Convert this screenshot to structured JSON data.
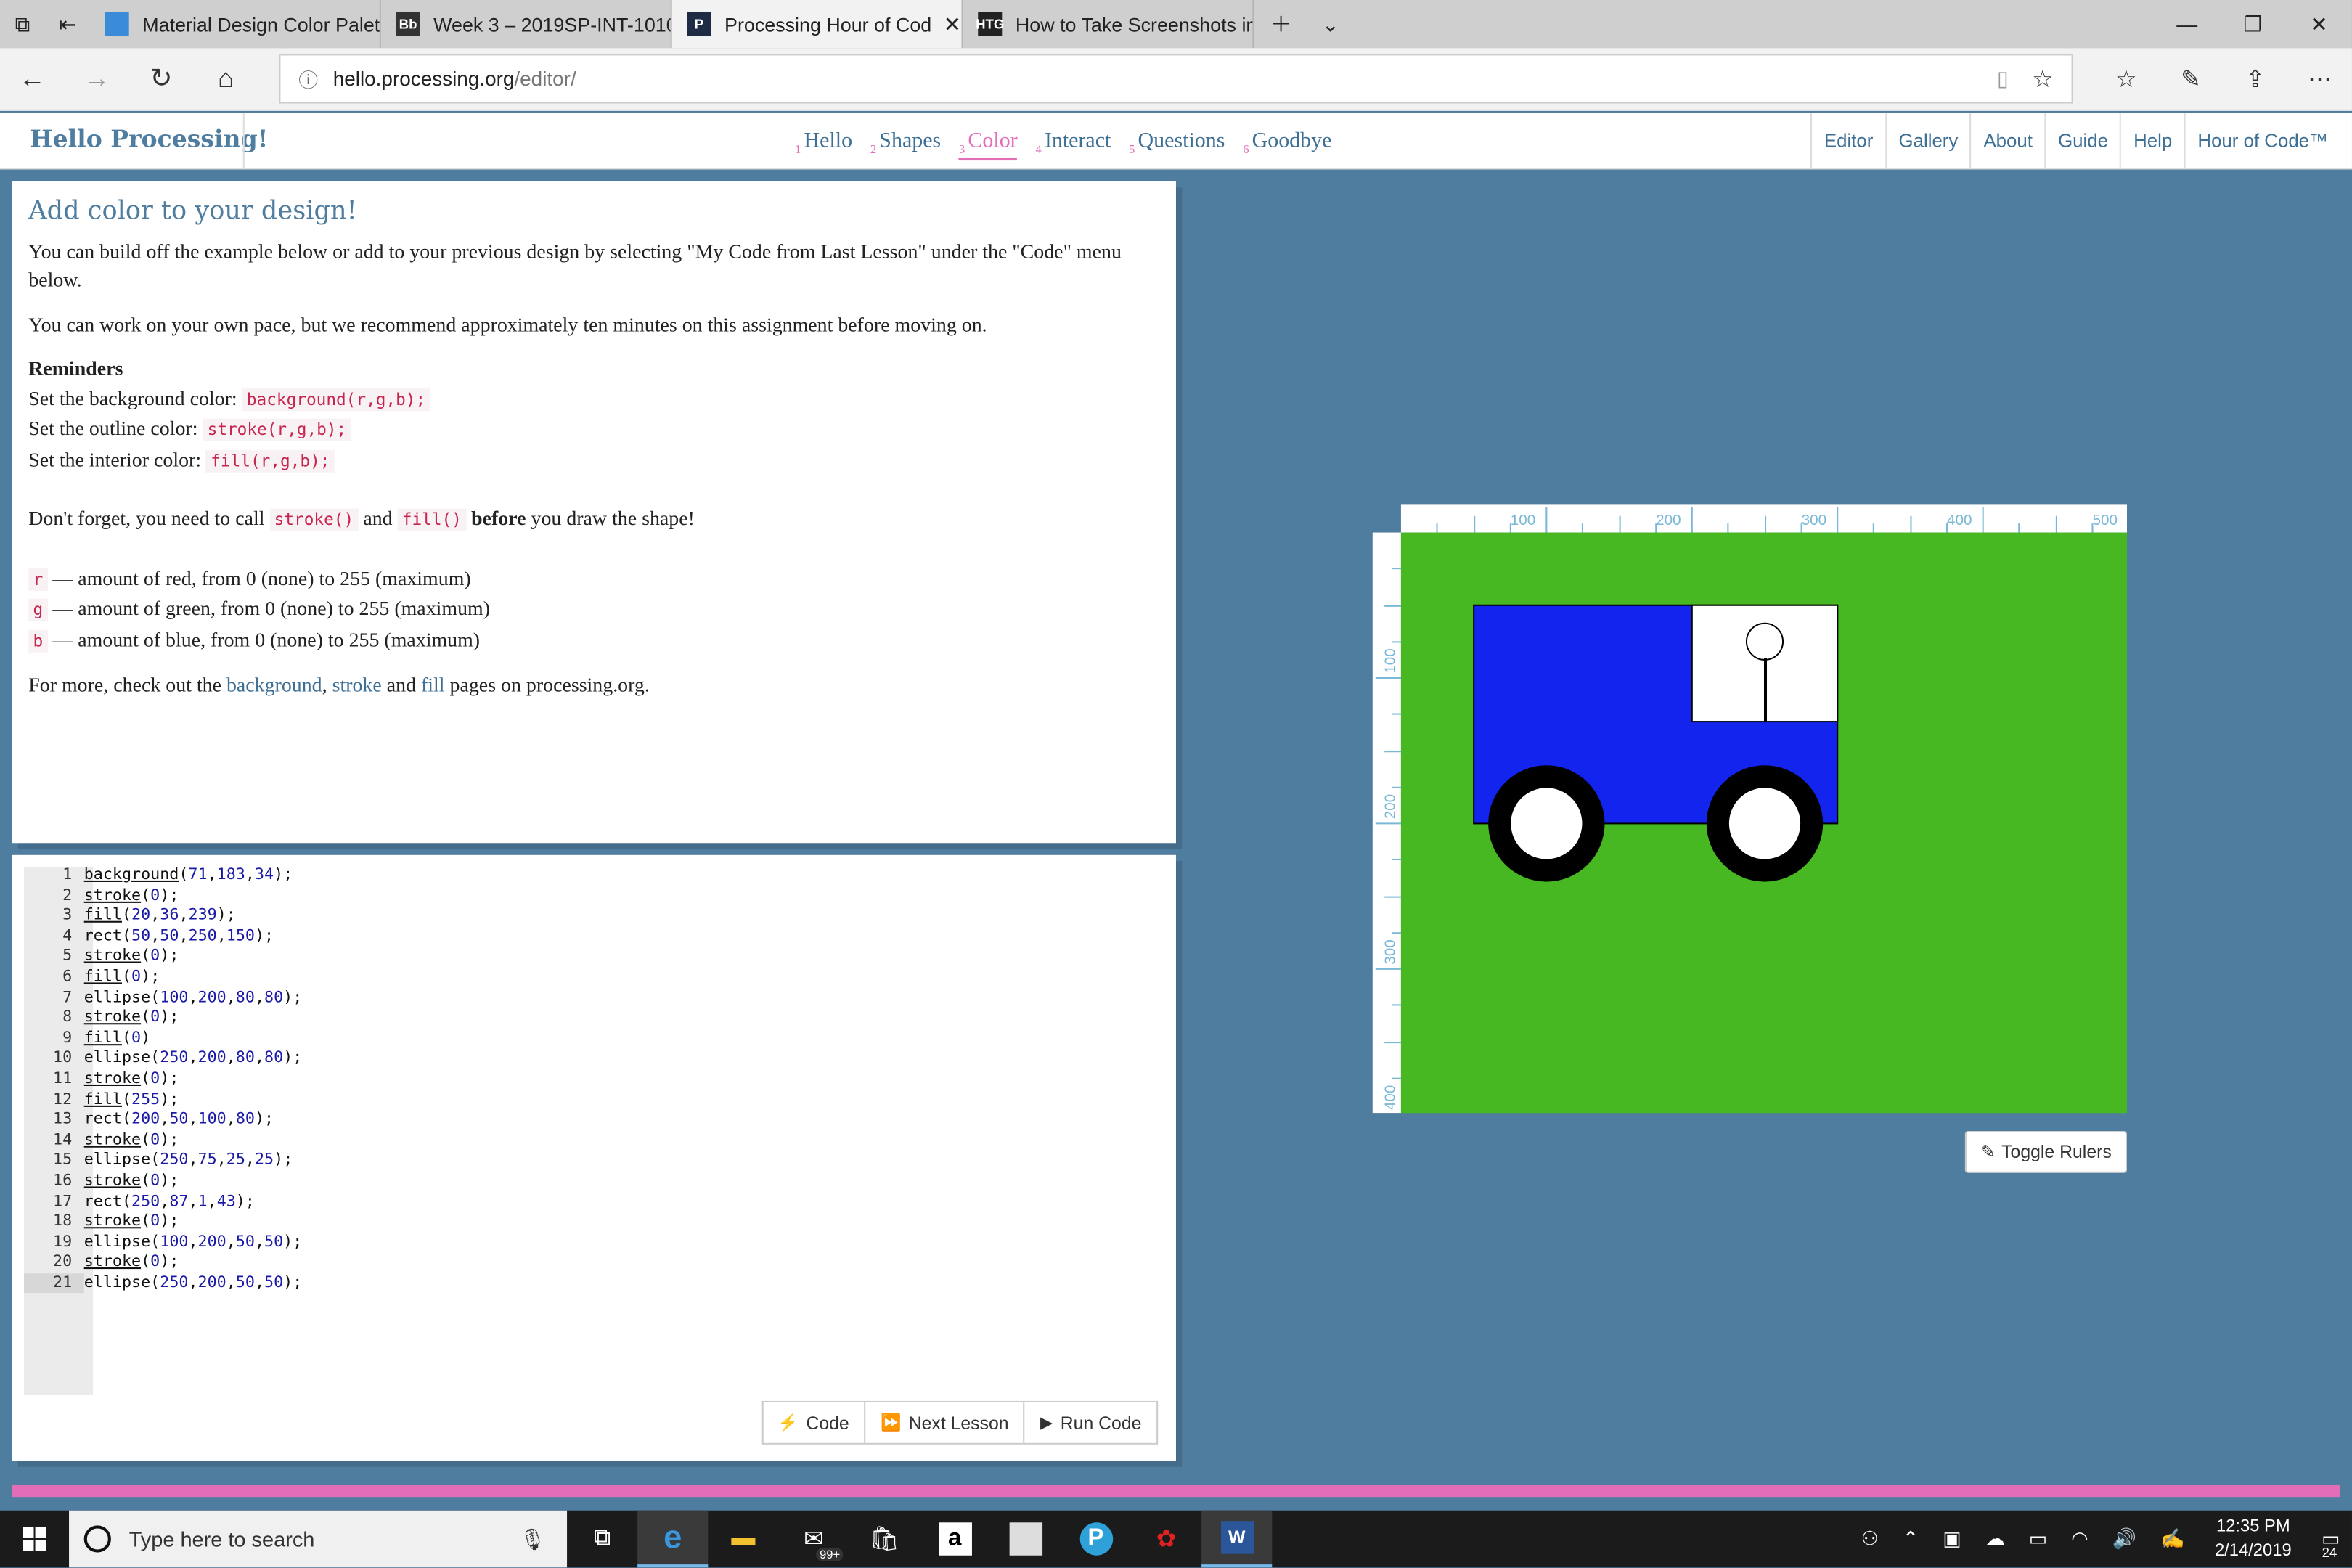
{
  "browser": {
    "tabs": [
      {
        "title": "Material Design Color Palett",
        "icon": "material-icon",
        "color": "#3a8bd8"
      },
      {
        "title": "Week 3 – 2019SP-INT-1010",
        "icon": "bb-icon",
        "color": "#333"
      },
      {
        "title": "Processing Hour of Cod",
        "icon": "processing-icon",
        "color": "#1d2b45",
        "active": true
      },
      {
        "title": "How to Take Screenshots in",
        "icon": "htg-icon",
        "color": "#222"
      }
    ],
    "url_host": "hello.processing.org",
    "url_path": "/editor/"
  },
  "site": {
    "logo": "Hello Processing!",
    "lessons": [
      {
        "num": "1",
        "label": "Hello"
      },
      {
        "num": "2",
        "label": "Shapes"
      },
      {
        "num": "3",
        "label": "Color",
        "active": true
      },
      {
        "num": "4",
        "label": "Interact"
      },
      {
        "num": "5",
        "label": "Questions"
      },
      {
        "num": "6",
        "label": "Goodbye"
      }
    ],
    "nav": [
      "Editor",
      "Gallery",
      "About",
      "Guide",
      "Help",
      "Hour of Code™"
    ]
  },
  "instructions": {
    "title": "Add color to your design!",
    "p1": "You can build off the example below or add to your previous design by selecting \"My Code from Last Lesson\" under the \"Code\" menu below.",
    "p2": "You can work on your own pace, but we recommend approximately ten minutes on this assignment before moving on.",
    "reminders_heading": "Reminders",
    "bg_label": "Set the background color:",
    "bg_code": "background(r,g,b);",
    "outline_label": "Set the outline color:",
    "outline_code": "stroke(r,g,b);",
    "interior_label": "Set the interior color:",
    "interior_code": "fill(r,g,b);",
    "forget_pre": "Don't forget, you need to call",
    "forget_code1": "stroke()",
    "forget_and": "and",
    "forget_code2": "fill()",
    "forget_bold": "before",
    "forget_post": "you draw the shape!",
    "r_code": "r",
    "r_text": "— amount of red, from 0 (none) to 255 (maximum)",
    "g_code": "g",
    "g_text": "— amount of green, from 0 (none) to 255 (maximum)",
    "b_code": "b",
    "b_text": "— amount of blue, from 0 (none) to 255 (maximum)",
    "more_pre": "For more, check out the",
    "link_background": "background",
    "link_stroke": "stroke",
    "more_and": "and",
    "link_fill": "fill",
    "more_post": "pages on processing.org."
  },
  "code": {
    "lines": [
      "background(71,183,34);",
      "stroke(0);",
      "fill(20,36,239);",
      "rect(50,50,250,150);",
      "stroke(0);",
      "fill(0);",
      "ellipse(100,200,80,80);",
      "stroke(0);",
      "fill(0)",
      "ellipse(250,200,80,80);",
      "stroke(0);",
      "fill(255);",
      "rect(200,50,100,80);",
      "stroke(0);",
      "ellipse(250,75,25,25);",
      "stroke(0);",
      "rect(250,87,1,43);",
      "stroke(0);",
      "ellipse(100,200,50,50);",
      "stroke(0);",
      "ellipse(250,200,50,50);"
    ],
    "current_line": 21,
    "buttons": {
      "code": "Code",
      "next": "Next Lesson",
      "run": "Run Code"
    }
  },
  "canvas": {
    "background": "#47b722",
    "top_ruler": [
      "100",
      "200",
      "300",
      "400",
      "500"
    ],
    "left_ruler": [
      "100",
      "200",
      "300",
      "400"
    ],
    "toggle_label": "Toggle Rulers"
  },
  "taskbar": {
    "search_placeholder": "Type here to search",
    "badge": "99+",
    "time": "12:35 PM",
    "date": "2/14/2019",
    "notifications": "24"
  }
}
